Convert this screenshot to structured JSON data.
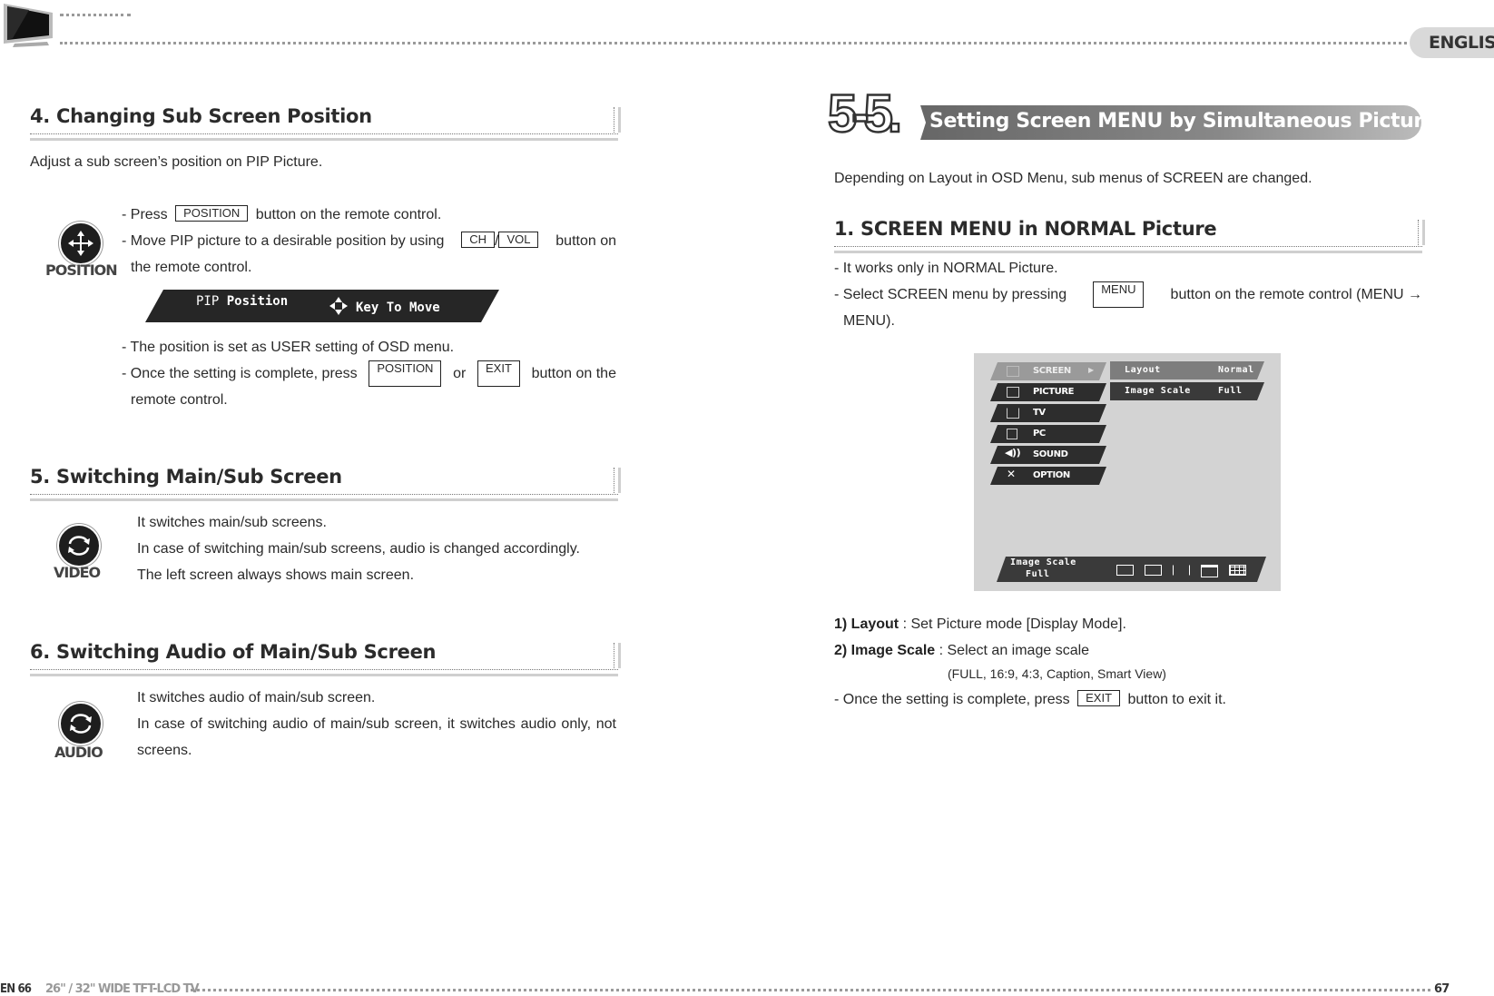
{
  "header": {
    "language": "ENGLISH",
    "tv_icon": "flat-tv-icon"
  },
  "left": {
    "sec4": {
      "title": "4. Changing Sub Screen Position",
      "intro": "Adjust a sub screen’s position on PIP Picture.",
      "icon_label": "POSITION",
      "l1_pre": "- Press",
      "l1_key": "POSITION",
      "l1_post": "button on the remote control.",
      "l2_pre": "- Move PIP picture to a desirable position by using",
      "l2_key1": "CH",
      "l2_sep": "/",
      "l2_key2": "VOL",
      "l2_post": "button on",
      "l2_cont": "the remote control.",
      "pip_bar": {
        "label_prefix": "PIP",
        "label": "Position",
        "hint": "Key To Move"
      },
      "l3": "- The position is set as USER setting of OSD menu.",
      "l4_pre": "- Once the setting is complete, press",
      "l4_key1": "POSITION",
      "l4_or": "or",
      "l4_key2": "EXIT",
      "l4_post": "button on the",
      "l4_cont": "remote control."
    },
    "sec5": {
      "title": "5. Switching Main/Sub Screen",
      "icon_label": "VIDEO",
      "lines": [
        "It switches main/sub screens.",
        "In case of switching main/sub screens, audio is changed accordingly.",
        "The left screen always shows main screen."
      ]
    },
    "sec6": {
      "title": "6. Switching Audio of Main/Sub Screen",
      "icon_label": "AUDIO",
      "lines": [
        "It switches audio of main/sub screen.",
        "In case of switching audio of main/sub screen, it switches audio only, not",
        "screens."
      ]
    }
  },
  "right": {
    "chapter_num": "5-5.",
    "chapter_title": "Setting Screen MENU by Simultaneous Picture",
    "intro": "Depending on Layout in OSD Menu, sub menus of SCREEN are changed.",
    "sec1": {
      "title_a": "1. SCREEN MENU",
      "title_b": "in",
      "title_c": "NORMAL",
      "title_d": "Picture",
      "l1": "- It works only in NORMAL Picture.",
      "l2_pre": "- Select SCREEN menu by pressing",
      "l2_key": "MENU",
      "l2_post": "button on the remote control (MENU  →",
      "l2_cont": "MENU)."
    },
    "osd": {
      "menu": [
        {
          "label": "SCREEN",
          "icon": "screen-icon",
          "selected": true
        },
        {
          "label": "PICTURE",
          "icon": "picture-icon",
          "selected": false
        },
        {
          "label": "TV",
          "icon": "tv-icon",
          "selected": false
        },
        {
          "label": "PC",
          "icon": "pc-icon",
          "selected": false
        },
        {
          "label": "SOUND",
          "icon": "sound-icon",
          "selected": false
        },
        {
          "label": "OPTION",
          "icon": "option-icon",
          "selected": false
        }
      ],
      "submenu": [
        {
          "label": "Layout",
          "value": "Normal",
          "selected": true
        },
        {
          "label": "Image Scale",
          "value": "Full",
          "selected": false
        }
      ],
      "bottom": {
        "label": "Image Scale",
        "value": "Full"
      }
    },
    "defs": [
      {
        "term": "1) Layout",
        "desc": " : Set Picture mode [Display Mode]."
      },
      {
        "term": "2) Image Scale",
        "desc": " : Select an image scale"
      }
    ],
    "options_note": "(FULL, 16:9, 4:3, Caption, Smart View)",
    "exit_pre": "- Once the setting is complete, press",
    "exit_key": "EXIT",
    "exit_post": "button to exit it."
  },
  "footer": {
    "left_page": "EN 66",
    "title": "26\" / 32\" WIDE TFT-LCD TV",
    "right_page": "67"
  }
}
